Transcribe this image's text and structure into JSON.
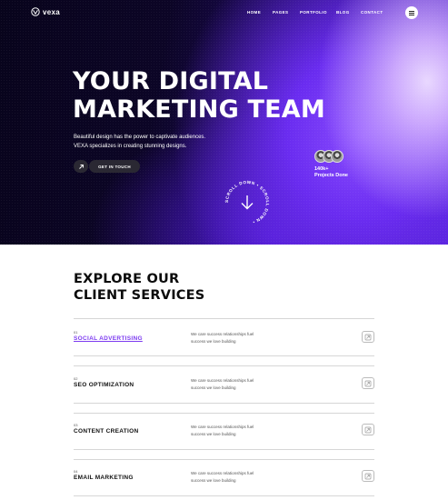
{
  "brand": {
    "logo_text": "vexa"
  },
  "nav": {
    "items": [
      "HOME",
      "PAGES",
      "PORTFOLIO",
      "BLOG",
      "CONTACT"
    ]
  },
  "hero": {
    "title_line1": "YOUR DIGITAL",
    "title_line2": "MARKETING TEAM",
    "desc_line1": "Beautiful design has the power to captivate audiences.",
    "desc_line2": "VEXA specializes in creating stunning designs.",
    "cta_label": "GET IN TOUCH",
    "projects_count": "140k+",
    "projects_label": "Projects Done",
    "scroll_text": "SCROLL DOWN • SCROLL DOWN • "
  },
  "services": {
    "title_line1": "EXPLORE OUR",
    "title_line2": "CLIENT SERVICES",
    "items": [
      {
        "num": "01",
        "name": "SOCIAL ADVERTISING",
        "desc_line1": "We care success relationships fuel",
        "desc_line2": "success we love building",
        "active": true
      },
      {
        "num": "02",
        "name": "SEO OPTIMIZATION",
        "desc_line1": "We care success relationships fuel",
        "desc_line2": "success we love building",
        "active": false
      },
      {
        "num": "03",
        "name": "CONTENT CREATION",
        "desc_line1": "We care success relationships fuel",
        "desc_line2": "success we love building",
        "active": false
      },
      {
        "num": "04",
        "name": "EMAIL MARKETING",
        "desc_line1": "We care success relationships fuel",
        "desc_line2": "success we love building",
        "active": false
      }
    ]
  },
  "colors": {
    "accent": "#7d3cf0",
    "hero_dark": "#0c0526",
    "button_dark": "#2a2833"
  },
  "icons": [
    "vexa-logo-icon",
    "menu-icon",
    "arrow-up-right-icon",
    "arrow-down-icon",
    "service-card-icon"
  ]
}
